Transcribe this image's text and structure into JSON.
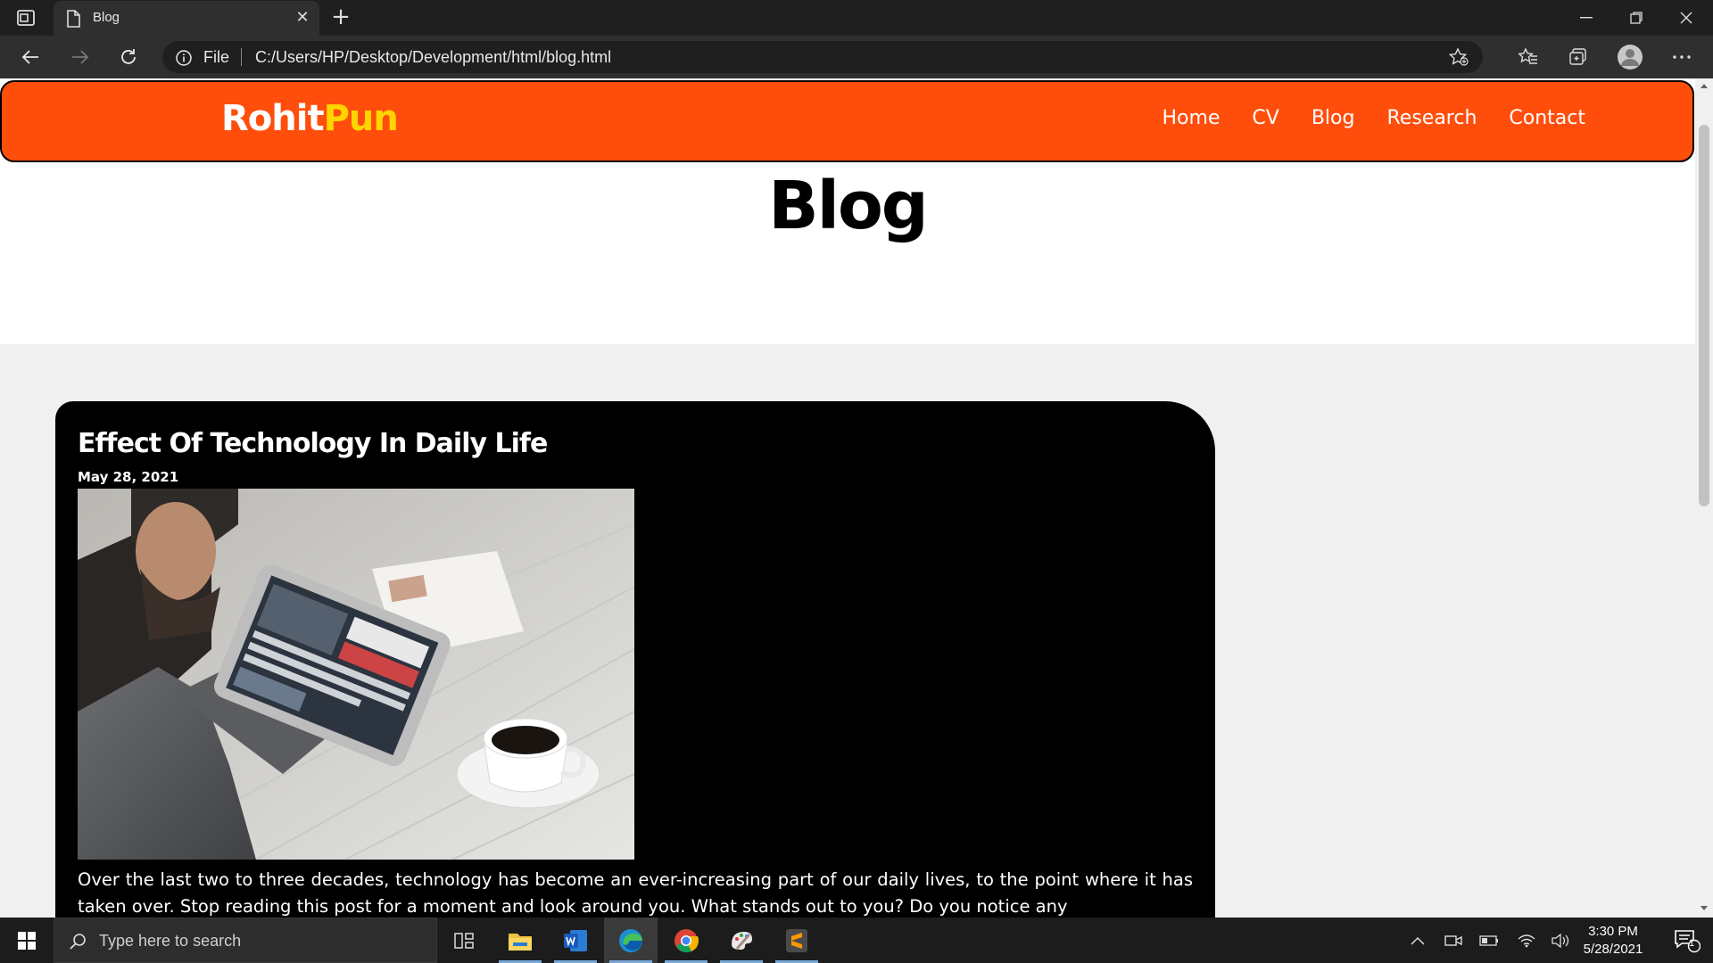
{
  "browser": {
    "tab": {
      "title": "Blog",
      "close": "✕"
    },
    "new_tab": "+",
    "address": {
      "scheme": "File",
      "url": "C:/Users/HP/Desktop/Development/html/blog.html"
    }
  },
  "site": {
    "brand_part1": "Rohit",
    "brand_part2": "Pun",
    "nav": [
      "Home",
      "CV",
      "Blog",
      "Research",
      "Contact"
    ],
    "page_title": "Blog",
    "colors": {
      "navbar": "#ff4e0c",
      "brand_accent": "#ffd400",
      "card": "#000000"
    }
  },
  "post": {
    "title": "Effect Of Technology In Daily Life",
    "date": "May 28, 2021",
    "image_icon": "man-using-tablet-with-coffee-photo",
    "body": "Over the last two to three decades, technology has become an ever-increasing part of our daily lives, to the point where it has taken over. Stop reading this post for a moment and look around you. What stands out to you? Do you notice any"
  },
  "taskbar": {
    "search_placeholder": "Type here to search",
    "time": "3:30 PM",
    "date": "5/28/2021",
    "notification_count": "1",
    "apps": [
      "task-view-icon",
      "file-explorer-icon",
      "word-icon",
      "edge-icon",
      "chrome-icon",
      "paint-icon",
      "sublime-text-icon"
    ]
  }
}
